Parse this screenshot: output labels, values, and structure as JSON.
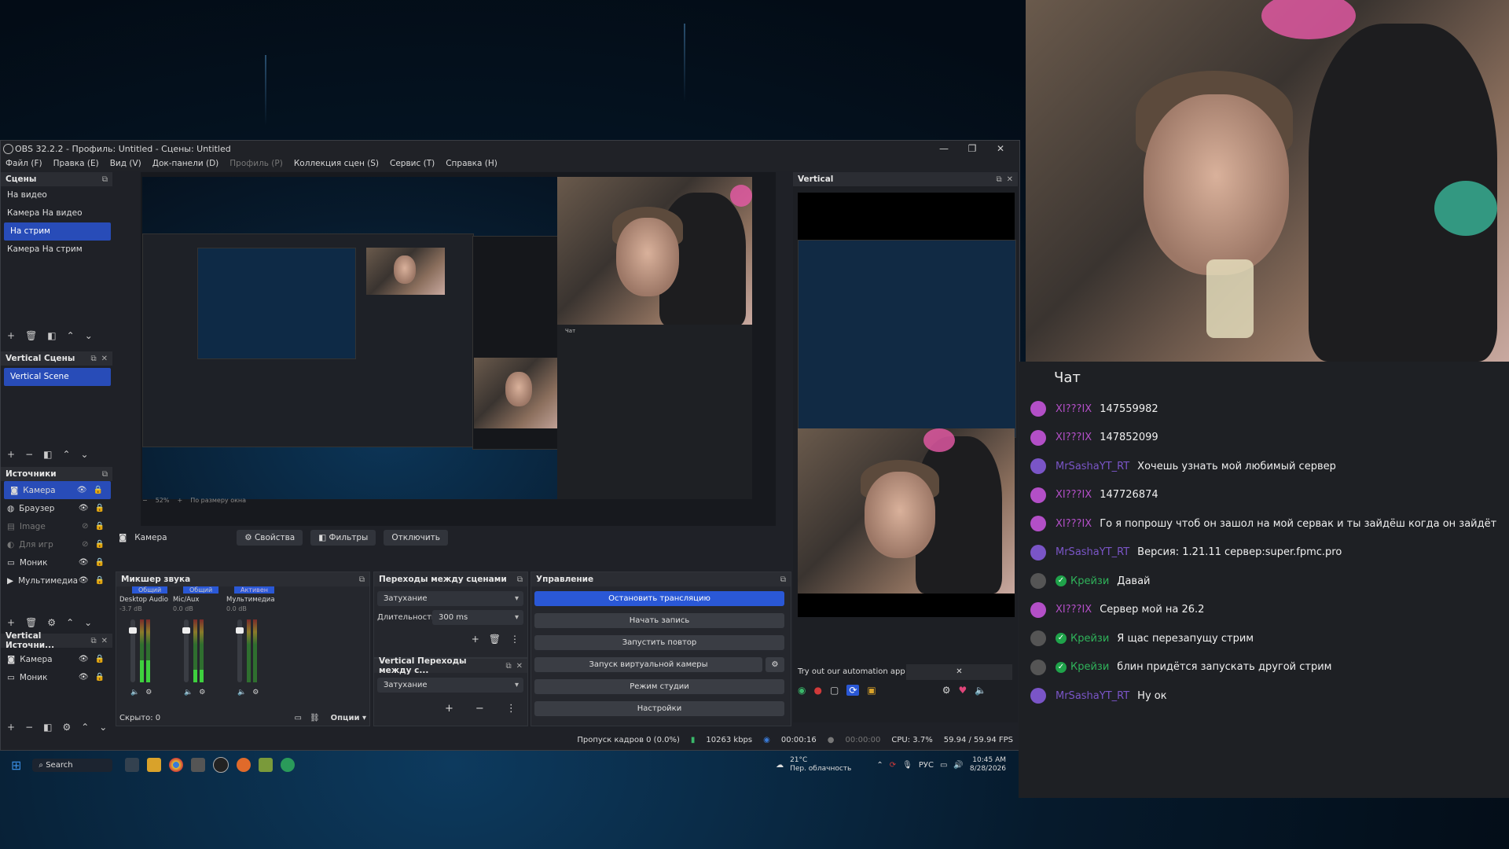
{
  "obs": {
    "title": "OBS 32.2.2 - Профиль: Untitled - Сцены: Untitled",
    "menu": [
      "Файл (F)",
      "Правка (E)",
      "Вид (V)",
      "Док-панели (D)",
      "Профиль (P)",
      "Коллекция сцен (S)",
      "Сервис (T)",
      "Справка (H)"
    ],
    "scenes_title": "Сцены",
    "scenes": [
      "На видео",
      "Камера На видео",
      "На стрим",
      "Камера На стрим"
    ],
    "selected_scene": "На стрим",
    "vscenes_title": "Vertical Сцены",
    "vscenes": [
      "Vertical Scene"
    ],
    "sources_title": "Источники",
    "sources": [
      {
        "name": "Камера",
        "icon": "camera-icon",
        "selected": true,
        "hidden": false
      },
      {
        "name": "Браузер",
        "icon": "globe-icon",
        "selected": false,
        "hidden": false
      },
      {
        "name": "Image",
        "icon": "image-icon",
        "selected": false,
        "hidden": true
      },
      {
        "name": "Для игр",
        "icon": "gamepad-icon",
        "selected": false,
        "hidden": true
      },
      {
        "name": "Моник",
        "icon": "monitor-icon",
        "selected": false,
        "hidden": false
      },
      {
        "name": "Мультимедиа",
        "icon": "play-icon",
        "selected": false,
        "hidden": false
      }
    ],
    "vsources_title": "Vertical Источни...",
    "vsources": [
      "Камера",
      "Моник"
    ],
    "source_bar": {
      "source": "Камера",
      "properties": "Свойства",
      "filters": "Фильтры",
      "disable": "Отключить"
    },
    "mixer": {
      "title": "Микшер звука",
      "tabs": [
        "Общий",
        "Общий",
        "Активен"
      ],
      "channels": [
        {
          "name": "Desktop Audio",
          "db": "-3.7 dB",
          "level": 0.35
        },
        {
          "name": "Mic/Aux",
          "db": "0.0 dB",
          "level": 0.2
        },
        {
          "name": "Мультимедиа",
          "db": "0.0 dB",
          "level": 0.0
        }
      ],
      "hidden": "Скрыто: 0",
      "options": "Опции"
    },
    "transitions": {
      "title": "Переходы между сценами",
      "type": "Затухание",
      "duration_label": "Длительность",
      "duration": "300 ms"
    },
    "vtransitions": {
      "title": "Vertical Переходы между с...",
      "type": "Затухание"
    },
    "controls": {
      "title": "Управление",
      "buttons": [
        "Остановить трансляцию",
        "Начать запись",
        "Запустить повтор",
        "Запуск виртуальной камеры",
        "Режим студии",
        "Настройки"
      ]
    },
    "vertical": {
      "title": "Vertical",
      "automation": "Try out our automation app"
    },
    "zoom": "52%",
    "fit": "По размеру окна",
    "status": {
      "dropped": "Пропуск кадров 0 (0.0%)",
      "bitrate": "10263 kbps",
      "stream_time": "00:00:16",
      "rec_time": "00:00:00",
      "cpu": "CPU: 3.7%",
      "fps": "59.94 / 59.94 FPS"
    }
  },
  "taskbar": {
    "search": "Search",
    "weather_temp": "21°C",
    "weather_desc": "Пер. облачность",
    "lang": "РУС",
    "time": "10:45 AM",
    "date": "8/28/2026"
  },
  "chat": {
    "title": "Чат",
    "messages": [
      {
        "user": "XI???IX",
        "text": "147559982",
        "color": "#b34fc7",
        "badge": false
      },
      {
        "user": "XI???IX",
        "text": "147852099",
        "color": "#b34fc7",
        "badge": false
      },
      {
        "user": "MrSashaYT_RT",
        "text": "Хочешь узнать мой любимый сервер",
        "color": "#7a55c7",
        "badge": false
      },
      {
        "user": "XI???IX",
        "text": "147726874",
        "color": "#b34fc7",
        "badge": false
      },
      {
        "user": "XI???IX",
        "text": "Го я попрошу чтоб он зашол на мой сервак и ты зайдёш когда он зайдёт",
        "color": "#b34fc7",
        "badge": false
      },
      {
        "user": "MrSashaYT_RT",
        "text": "Версия: 1.21.11 сервер:super.fpmc.pro",
        "color": "#7a55c7",
        "badge": false
      },
      {
        "user": "Крейзи",
        "text": "Давай",
        "color": "#2fb35a",
        "badge": true
      },
      {
        "user": "XI???IX",
        "text": "Сервер мой на 26.2",
        "color": "#b34fc7",
        "badge": false
      },
      {
        "user": "Крейзи",
        "text": "Я щас перезапущу стрим",
        "color": "#2fb35a",
        "badge": true
      },
      {
        "user": "Крейзи",
        "text": "блин придётся запускать другой стрим",
        "color": "#2fb35a",
        "badge": true
      },
      {
        "user": "MrSashaYT_RT",
        "text": "Ну ок",
        "color": "#7a55c7",
        "badge": false
      }
    ]
  }
}
